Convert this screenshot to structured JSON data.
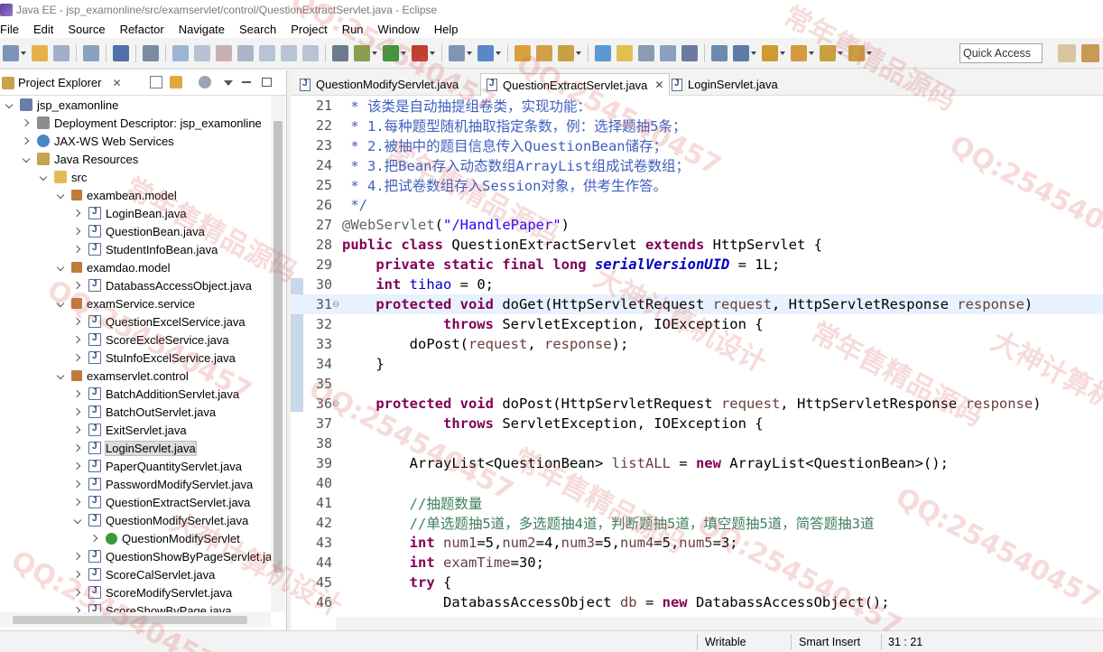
{
  "window": {
    "title": "Java EE - jsp_examonline/src/examservlet/control/QuestionExtractServlet.java - Eclipse"
  },
  "menubar": [
    "File",
    "Edit",
    "Source",
    "Refactor",
    "Navigate",
    "Search",
    "Project",
    "Run",
    "Window",
    "Help"
  ],
  "toolbar": {
    "quick_access": "Quick Access"
  },
  "project_explorer": {
    "title": "Project Explorer",
    "close_label": "✕",
    "tree": [
      {
        "label": "jsp_examonline",
        "icon": "project-icon",
        "depth": 0,
        "state": "expanded"
      },
      {
        "label": "Deployment Descriptor: jsp_examonline",
        "icon": "descriptor-icon",
        "depth": 1,
        "state": "collapsed"
      },
      {
        "label": "JAX-WS Web Services",
        "icon": "webservice-icon",
        "depth": 1,
        "state": "collapsed"
      },
      {
        "label": "Java Resources",
        "icon": "java-resources-icon",
        "depth": 1,
        "state": "expanded"
      },
      {
        "label": "src",
        "icon": "source-folder-icon",
        "depth": 2,
        "state": "expanded"
      },
      {
        "label": "exambean.model",
        "icon": "package-icon",
        "depth": 3,
        "state": "expanded"
      },
      {
        "label": "LoginBean.java",
        "icon": "java-file-icon",
        "depth": 4,
        "state": "collapsed"
      },
      {
        "label": "QuestionBean.java",
        "icon": "java-file-icon",
        "depth": 4,
        "state": "collapsed"
      },
      {
        "label": "StudentInfoBean.java",
        "icon": "java-file-icon",
        "depth": 4,
        "state": "collapsed"
      },
      {
        "label": "examdao.model",
        "icon": "package-icon",
        "depth": 3,
        "state": "expanded"
      },
      {
        "label": "DatabassAccessObject.java",
        "icon": "java-file-icon",
        "depth": 4,
        "state": "collapsed"
      },
      {
        "label": "examService.service",
        "icon": "package-icon",
        "depth": 3,
        "state": "expanded"
      },
      {
        "label": "QuestionExcelService.java",
        "icon": "java-file-icon",
        "depth": 4,
        "state": "collapsed"
      },
      {
        "label": "ScoreExcleService.java",
        "icon": "java-file-icon",
        "depth": 4,
        "state": "collapsed"
      },
      {
        "label": "StuInfoExcelService.java",
        "icon": "java-file-icon",
        "depth": 4,
        "state": "collapsed"
      },
      {
        "label": "examservlet.control",
        "icon": "package-icon",
        "depth": 3,
        "state": "expanded"
      },
      {
        "label": "BatchAdditionServlet.java",
        "icon": "java-file-icon",
        "depth": 4,
        "state": "collapsed"
      },
      {
        "label": "BatchOutServlet.java",
        "icon": "java-file-icon",
        "depth": 4,
        "state": "collapsed"
      },
      {
        "label": "ExitServlet.java",
        "icon": "java-file-icon",
        "depth": 4,
        "state": "collapsed"
      },
      {
        "label": "LoginServlet.java",
        "icon": "java-file-icon",
        "depth": 4,
        "state": "collapsed",
        "selected": true
      },
      {
        "label": "PaperQuantityServlet.java",
        "icon": "java-file-icon",
        "depth": 4,
        "state": "collapsed"
      },
      {
        "label": "PasswordModifyServlet.java",
        "icon": "java-file-icon",
        "depth": 4,
        "state": "collapsed"
      },
      {
        "label": "QuestionExtractServlet.java",
        "icon": "java-file-icon",
        "depth": 4,
        "state": "collapsed"
      },
      {
        "label": "QuestionModifyServlet.java",
        "icon": "java-file-icon",
        "depth": 4,
        "state": "expanded"
      },
      {
        "label": "QuestionModifyServlet",
        "icon": "class-icon",
        "depth": 5,
        "state": "collapsed"
      },
      {
        "label": "QuestionShowByPageServlet.jav",
        "icon": "java-file-icon",
        "depth": 4,
        "state": "collapsed"
      },
      {
        "label": "ScoreCalServlet.java",
        "icon": "java-file-icon",
        "depth": 4,
        "state": "collapsed"
      },
      {
        "label": "ScoreModifyServlet.java",
        "icon": "java-file-icon",
        "depth": 4,
        "state": "collapsed"
      },
      {
        "label": "ScoreShowByPage.java",
        "icon": "java-file-icon",
        "depth": 4,
        "state": "collapsed"
      }
    ]
  },
  "editor": {
    "tabs": [
      {
        "label": "QuestionModifyServlet.java",
        "active": false
      },
      {
        "label": "QuestionExtractServlet.java",
        "active": true,
        "close": "✕"
      },
      {
        "label": "LoginServlet.java",
        "active": false
      }
    ],
    "current_line": 31,
    "lines": [
      {
        "n": "21",
        "tokens": [
          [
            " * 该类是自动抽提组卷类，实现功能：",
            "jd"
          ]
        ]
      },
      {
        "n": "22",
        "tokens": [
          [
            " * 1.每种题型随机抽取指定条数，例：选择题抽5条；",
            "jd"
          ]
        ]
      },
      {
        "n": "23",
        "tokens": [
          [
            " * 2.被抽中的题目信息传入QuestionBean储存；",
            "jd"
          ]
        ]
      },
      {
        "n": "24",
        "tokens": [
          [
            " * 3.把Bean存入动态数组ArrayList组成试卷数组；",
            "jd"
          ]
        ]
      },
      {
        "n": "25",
        "tokens": [
          [
            " * 4.把试卷数组存入Session对象，供考生作答。",
            "jd"
          ]
        ]
      },
      {
        "n": "26",
        "tokens": [
          [
            " */",
            "jd"
          ]
        ]
      },
      {
        "n": "27",
        "tokens": [
          [
            "@WebServlet",
            "an"
          ],
          [
            "(",
            ""
          ],
          [
            "\"/HandlePaper\"",
            "st"
          ],
          [
            ")",
            ""
          ]
        ]
      },
      {
        "n": "28",
        "tokens": [
          [
            "public class ",
            "kw"
          ],
          [
            "QuestionExtractServlet ",
            ""
          ],
          [
            "extends ",
            "kw"
          ],
          [
            "HttpServlet {",
            ""
          ]
        ]
      },
      {
        "n": "29",
        "tokens": [
          [
            "    ",
            ""
          ],
          [
            "private static final long ",
            "kw"
          ],
          [
            "serialVersionUID",
            "sf"
          ],
          [
            " = 1L;",
            ""
          ]
        ]
      },
      {
        "n": "30",
        "tokens": [
          [
            "    ",
            ""
          ],
          [
            "int ",
            "kw"
          ],
          [
            "tihao",
            "fd"
          ],
          [
            " = 0;",
            ""
          ]
        ]
      },
      {
        "n": "31",
        "fold": "⊖",
        "tokens": [
          [
            "    ",
            ""
          ],
          [
            "protected void ",
            "kw"
          ],
          [
            "doGet(HttpServletRequest ",
            ""
          ],
          [
            "request",
            "pm"
          ],
          [
            ", HttpServletResponse ",
            ""
          ],
          [
            "response",
            "pm"
          ],
          [
            ")",
            ""
          ]
        ]
      },
      {
        "n": "32",
        "tokens": [
          [
            "            ",
            ""
          ],
          [
            "throws ",
            "kw"
          ],
          [
            "ServletException, IOException {",
            ""
          ]
        ]
      },
      {
        "n": "33",
        "tokens": [
          [
            "        doPost(",
            ""
          ],
          [
            "request",
            "pm"
          ],
          [
            ", ",
            ""
          ],
          [
            "response",
            "pm"
          ],
          [
            ");",
            ""
          ]
        ]
      },
      {
        "n": "34",
        "tokens": [
          [
            "    }",
            ""
          ]
        ]
      },
      {
        "n": "35",
        "tokens": [
          [
            "",
            ""
          ]
        ]
      },
      {
        "n": "36",
        "fold": "⊖",
        "tokens": [
          [
            "    ",
            ""
          ],
          [
            "protected void ",
            "kw"
          ],
          [
            "doPost(HttpServletRequest ",
            ""
          ],
          [
            "request",
            "pm"
          ],
          [
            ", HttpServletResponse ",
            ""
          ],
          [
            "response",
            "pm"
          ],
          [
            ")",
            ""
          ]
        ]
      },
      {
        "n": "37",
        "tokens": [
          [
            "            ",
            ""
          ],
          [
            "throws ",
            "kw"
          ],
          [
            "ServletException, IOException {",
            ""
          ]
        ]
      },
      {
        "n": "38",
        "tokens": [
          [
            "",
            ""
          ]
        ]
      },
      {
        "n": "39",
        "tokens": [
          [
            "        ArrayList<QuestionBean> ",
            ""
          ],
          [
            "listALL",
            "lv"
          ],
          [
            " = ",
            ""
          ],
          [
            "new ",
            "kw"
          ],
          [
            "ArrayList<QuestionBean>();",
            ""
          ]
        ]
      },
      {
        "n": "40",
        "tokens": [
          [
            "",
            ""
          ]
        ]
      },
      {
        "n": "41",
        "tokens": [
          [
            "        ",
            ""
          ],
          [
            "//抽题数量",
            "cm"
          ]
        ]
      },
      {
        "n": "42",
        "tokens": [
          [
            "        ",
            ""
          ],
          [
            "//单选题抽5道，多选题抽4道，判断题抽5道，填空题抽5道，简答题抽3道",
            "cm"
          ]
        ]
      },
      {
        "n": "43",
        "tokens": [
          [
            "        ",
            ""
          ],
          [
            "int ",
            "kw"
          ],
          [
            "num1",
            "lv"
          ],
          [
            "=5,",
            ""
          ],
          [
            "num2",
            "lv"
          ],
          [
            "=4,",
            ""
          ],
          [
            "num3",
            "lv"
          ],
          [
            "=5,",
            ""
          ],
          [
            "num4",
            "lv"
          ],
          [
            "=5,",
            ""
          ],
          [
            "num5",
            "lv"
          ],
          [
            "=3;",
            ""
          ]
        ]
      },
      {
        "n": "44",
        "tokens": [
          [
            "        ",
            ""
          ],
          [
            "int ",
            "kw"
          ],
          [
            "examTime",
            "lv"
          ],
          [
            "=30;",
            ""
          ]
        ]
      },
      {
        "n": "45",
        "tokens": [
          [
            "        ",
            ""
          ],
          [
            "try ",
            "kw"
          ],
          [
            "{",
            ""
          ]
        ]
      },
      {
        "n": "46",
        "tokens": [
          [
            "            DatabassAccessObject ",
            ""
          ],
          [
            "db",
            "lv"
          ],
          [
            " = ",
            ""
          ],
          [
            "new ",
            "kw"
          ],
          [
            "DatabassAccessObject();",
            ""
          ]
        ]
      }
    ]
  },
  "statusbar": {
    "mode": "Writable",
    "insert": "Smart Insert",
    "position": "31 : 21"
  },
  "watermark": [
    "QQ:254540457",
    "常年售精品源码",
    "大神计算机设计"
  ]
}
